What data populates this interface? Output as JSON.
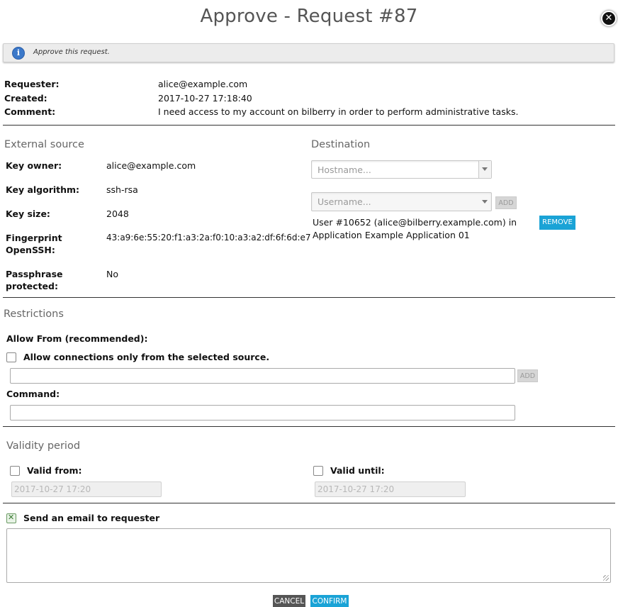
{
  "dialog": {
    "title": "Approve - Request #87",
    "close_icon": "close-icon"
  },
  "info": {
    "icon": "info-icon",
    "text": "Approve this request."
  },
  "request": {
    "requester_label": "Requester:",
    "requester_value": "alice@example.com",
    "created_label": "Created:",
    "created_value": "2017-10-27 17:18:40",
    "comment_label": "Comment:",
    "comment_value": "I need access to my account on bilberry in order to perform administrative tasks."
  },
  "external_source": {
    "heading": "External source",
    "key_owner_label": "Key owner:",
    "key_owner_value": "alice@example.com",
    "key_algorithm_label": "Key algorithm:",
    "key_algorithm_value": "ssh-rsa",
    "key_size_label": "Key size:",
    "key_size_value": "2048",
    "fingerprint_label_line1": "Fingerprint",
    "fingerprint_label_line2": "OpenSSH:",
    "fingerprint_value": "43:a9:6e:55:20:f1:a3:2a:f0:10:a3:a2:df:6f:6d:e7",
    "passphrase_label_line1": "Passphrase",
    "passphrase_label_line2": "protected:",
    "passphrase_value": "No"
  },
  "destination": {
    "heading": "Destination",
    "hostname_placeholder": "Hostname...",
    "username_placeholder": "Username...",
    "add_label": "ADD",
    "entry_line1": "User #10652 (alice@bilberry.example.com) in",
    "entry_line2": "Application Example Application 01",
    "remove_label": "REMOVE"
  },
  "restrictions": {
    "heading": "Restrictions",
    "allow_from_label": "Allow From (recommended):",
    "allow_source_label": "Allow connections only from the selected source.",
    "add_label": "ADD",
    "command_label": "Command:"
  },
  "validity": {
    "heading": "Validity period",
    "valid_from_label": "Valid from:",
    "valid_from_value": "2017-10-27 17:20",
    "valid_until_label": "Valid until:",
    "valid_until_value": "2017-10-27 17:20"
  },
  "email": {
    "label": "Send an email to requester",
    "checked": true
  },
  "footer": {
    "cancel_label": "CANCEL",
    "confirm_label": "CONFIRM"
  },
  "colors": {
    "accent": "#1aa3d6",
    "cancel": "#555555",
    "info_icon": "#3b78c9"
  }
}
